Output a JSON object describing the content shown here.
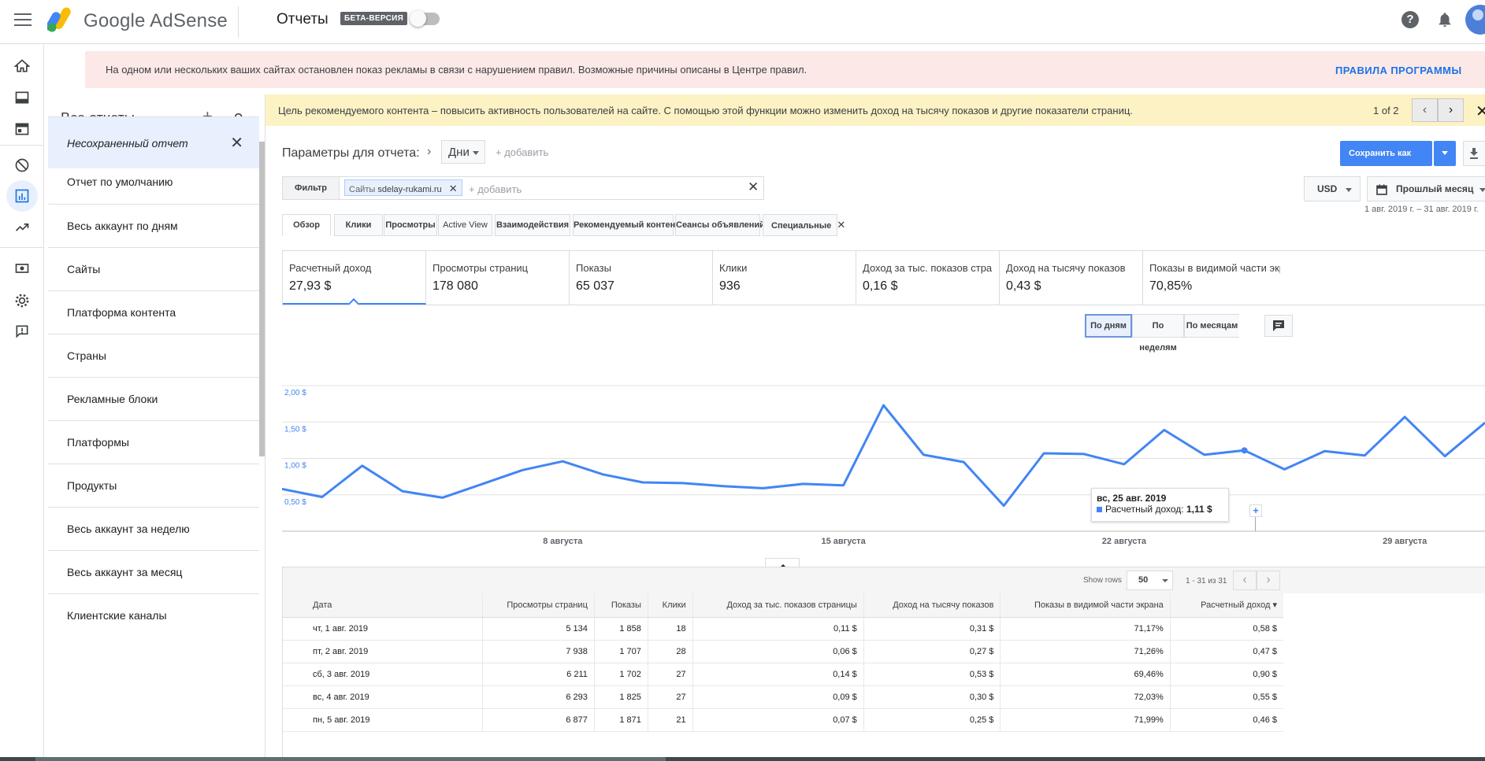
{
  "app": {
    "brand": "Google AdSense",
    "section_title": "Отчеты",
    "beta_label": "БЕТА-ВЕРСИЯ",
    "help_label": "?"
  },
  "policy_banner": {
    "message": "На одном или нескольких ваших сайтах остановлен показ рекламы в связи с нарушением правил. Возможные причины описаны в Центре правил.",
    "link": "ПРАВИЛА ПРОГРАММЫ"
  },
  "reports_panel": {
    "title": "Все отчеты",
    "items": [
      "Несохраненный отчет",
      "Отчет по умолчанию",
      "Весь аккаунт по дням",
      "Сайты",
      "Платформа контента",
      "Страны",
      "Рекламные блоки",
      "Платформы",
      "Продукты",
      "Весь аккаунт за неделю",
      "Весь аккаунт за месяц",
      "Клиентские каналы"
    ]
  },
  "recommendation_banner": {
    "message": "Цель рекомендуемого контента – повысить активность пользователей на сайте. С помощью этой функции можно изменить доход на тысячу показов и другие показатели страниц.",
    "pager": "1 of 2"
  },
  "params": {
    "label": "Параметры для отчета:",
    "dimension": "Дни",
    "add": "+ добавить"
  },
  "filter": {
    "button": "Фильтр",
    "chip_prefix": "Сайты",
    "chip_value": "sdelay-rukami.ru",
    "add": "+ добавить"
  },
  "actions": {
    "save_as": "Сохранить как",
    "currency": "USD",
    "period": "Прошлый месяц",
    "date_range": "1 авг. 2019 г. – 31 авг. 2019 г."
  },
  "tabs": [
    "Обзор",
    "Клики",
    "Просмотры",
    "Active View",
    "Взаимодействия",
    "Рекомендуемый контент",
    "Сеансы объявлений",
    "Специальные"
  ],
  "metrics": [
    {
      "name": "Расчетный доход",
      "value": "27,93 $"
    },
    {
      "name": "Просмотры страниц",
      "value": "178 080"
    },
    {
      "name": "Показы",
      "value": "65 037"
    },
    {
      "name": "Клики",
      "value": "936"
    },
    {
      "name": "Доход за тыс. показов страни...",
      "value": "0,16 $"
    },
    {
      "name": "Доход на тысячу показов",
      "value": "0,43 $"
    },
    {
      "name": "Показы в видимой части экрана",
      "value": "70,85%"
    }
  ],
  "granularity": [
    "По дням",
    "По неделям",
    "По месяцам"
  ],
  "chart_data": {
    "type": "line",
    "y_ticks": [
      "2,00 $",
      "1,50 $",
      "1,00 $",
      "0,50 $"
    ],
    "ylim": [
      0,
      2.0
    ],
    "x_ticks": [
      {
        "label": "8 августа",
        "day": 8
      },
      {
        "label": "15 августа",
        "day": 15
      },
      {
        "label": "22 августа",
        "day": 22
      },
      {
        "label": "29 августа",
        "day": 29
      }
    ],
    "series": [
      {
        "name": "Расчетный доход",
        "color": "#4285f4",
        "x": [
          1,
          2,
          3,
          4,
          5,
          6,
          7,
          8,
          9,
          10,
          11,
          12,
          13,
          14,
          15,
          16,
          17,
          18,
          19,
          20,
          21,
          22,
          23,
          24,
          25,
          26,
          27,
          28,
          29,
          30,
          31
        ],
        "values": [
          0.58,
          0.47,
          0.9,
          0.55,
          0.46,
          0.65,
          0.84,
          0.96,
          0.78,
          0.67,
          0.66,
          0.62,
          0.59,
          0.65,
          0.63,
          1.73,
          1.05,
          0.95,
          0.35,
          1.07,
          1.06,
          0.92,
          1.39,
          1.05,
          1.11,
          0.85,
          1.1,
          1.04,
          1.57,
          1.03,
          1.49
        ]
      }
    ],
    "tooltip": {
      "date": "вс, 25 авг. 2019",
      "series": "Расчетный доход:",
      "value": "1,11 $"
    }
  },
  "table": {
    "show_rows_label": "Show rows",
    "rows_value": "50",
    "range": "1 - 31 из 31",
    "columns": [
      "Дата",
      "Просмотры страниц",
      "Показы",
      "Клики",
      "Доход за тыс. показов страницы",
      "Доход на тысячу показов",
      "Показы в видимой части экрана",
      "Расчетный доход"
    ],
    "rows": [
      [
        "чт, 1 авг. 2019",
        "5 134",
        "1 858",
        "18",
        "0,11 $",
        "0,31 $",
        "71,17%",
        "0,58 $"
      ],
      [
        "пт, 2 авг. 2019",
        "7 938",
        "1 707",
        "28",
        "0,06 $",
        "0,27 $",
        "71,26%",
        "0,47 $"
      ],
      [
        "сб, 3 авг. 2019",
        "6 211",
        "1 702",
        "27",
        "0,14 $",
        "0,53 $",
        "69,46%",
        "0,90 $"
      ],
      [
        "вс, 4 авг. 2019",
        "6 293",
        "1 825",
        "27",
        "0,09 $",
        "0,30 $",
        "72,03%",
        "0,55 $"
      ],
      [
        "пн, 5 авг. 2019",
        "6 877",
        "1 871",
        "21",
        "0,07 $",
        "0,25 $",
        "71,99%",
        "0,46 $"
      ]
    ]
  }
}
